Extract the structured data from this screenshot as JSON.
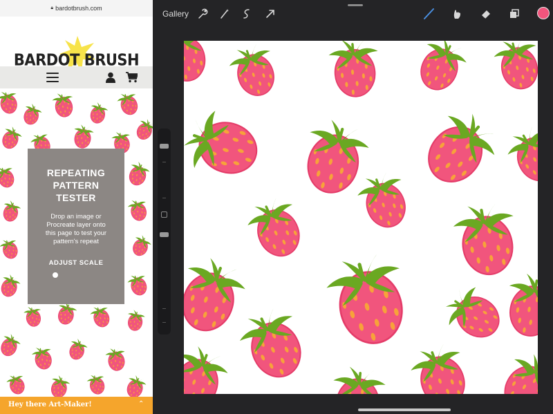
{
  "browser": {
    "url": "bardotbrush.com"
  },
  "site": {
    "logo_text": "BARDOT BRUSH",
    "tester": {
      "title_line1": "REPEATING",
      "title_line2": "PATTERN",
      "title_line3": "TESTER",
      "desc_line1": "Drop an image or",
      "desc_line2": "Procreate layer onto",
      "desc_line3": "this page to test your",
      "desc_line4": "pattern's repeat",
      "scale_label": "ADJUST SCALE",
      "scale_level": 0.16
    },
    "banner": {
      "text": "Hey there Art-Maker!",
      "chevron": "⌃"
    }
  },
  "procreate": {
    "gallery_label": "Gallery",
    "tools_left": [
      "wrench-icon",
      "magic-wand-icon",
      "selection-icon",
      "transform-arrow-icon"
    ],
    "tools_right": [
      "brush-icon",
      "smudge-icon",
      "eraser-icon",
      "layers-icon"
    ],
    "active_color": "#f1557d"
  },
  "colors": {
    "strawberry_pink": "#f1557d",
    "strawberry_seed": "#f7a23a",
    "leaf_green": "#6aa822",
    "panel_gray": "#8c8784",
    "banner_orange": "#f5a52c"
  }
}
